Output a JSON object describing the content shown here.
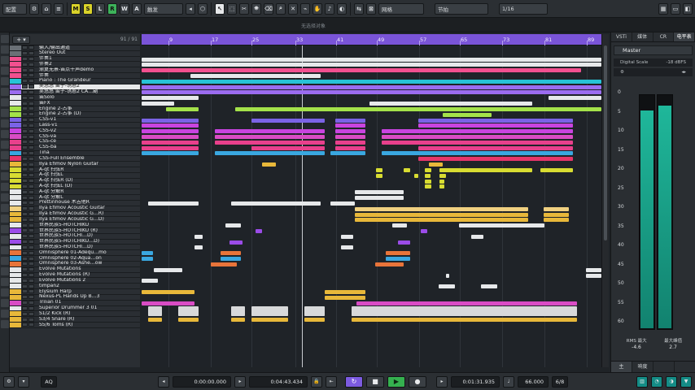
{
  "toolbar": {
    "layout_label": "配置",
    "ab_label": "A B",
    "m_label": "M",
    "s_label": "S",
    "l_label": "L",
    "r_label": "R",
    "w_label": "W",
    "a_label": "A",
    "mode_select": "触发",
    "snap_select": "网格",
    "grid_select": "节拍",
    "quantize_select": "1/16"
  },
  "subbar": {
    "status": "无选择对象"
  },
  "trackheader": {
    "add_label": "+ ▾",
    "count": "91 / 91"
  },
  "tracks": [
    {
      "name": "输入/输出通道",
      "color": "#6a7076"
    },
    {
      "name": "Stereo Out",
      "color": "#6a7076"
    },
    {
      "name": "伴奏1",
      "color": "#f2508f"
    },
    {
      "name": "伴奏2",
      "color": "#f2508f"
    },
    {
      "name": "渐复无景-笛点干声demo",
      "color": "#f2508f"
    },
    {
      "name": "伴奏",
      "color": "#f2508f"
    },
    {
      "name": "Piano : The Grandeur",
      "color": "#27c3d6"
    },
    {
      "name": "吴悠悠 笛子-诱惑2",
      "color": "#9b6cf0"
    },
    {
      "name": "吴悠悠 笛子-诱惑2 CA…副",
      "color": "#9b6cf0"
    },
    {
      "name": "笛Solo",
      "color": "#e6e8ea"
    },
    {
      "name": "笛FX",
      "color": "#e6e8ea"
    },
    {
      "name": "Engine 2-古筝",
      "color": "#a4e24a"
    },
    {
      "name": "Engine 2-古筝 (D)",
      "color": "#a4e24a"
    },
    {
      "name": "CSS-v1",
      "color": "#7b63e6"
    },
    {
      "name": "Lass-v1",
      "color": "#7b63e6"
    },
    {
      "name": "CSS-v2",
      "color": "#c944e0"
    },
    {
      "name": "CSS-va",
      "color": "#d94cc5"
    },
    {
      "name": "CSS-ce",
      "color": "#e8408c"
    },
    {
      "name": "CSS-ba",
      "color": "#e8408c"
    },
    {
      "name": "Tina",
      "color": "#3aa7e0"
    },
    {
      "name": "CSS-Full Ensemble",
      "color": "#e6356a"
    },
    {
      "name": "Ilya Efimov Nylon Guitar",
      "color": "#e8b83a"
    },
    {
      "name": "A-qt 扫弦R",
      "color": "#d8dc32"
    },
    {
      "name": "A-qt 扫弦L",
      "color": "#d8dc32"
    },
    {
      "name": "A-qt 扫弦R (D)",
      "color": "#d8dc32"
    },
    {
      "name": "A-qt 扫弦L (D)",
      "color": "#d8dc32"
    },
    {
      "name": "A-qt 分解R",
      "color": "#e6e8ea"
    },
    {
      "name": "A-qt 分解L",
      "color": "#e6e8ea"
    },
    {
      "name": "Prettinhouse 木吉他R",
      "color": "#e6e8ea"
    },
    {
      "name": "Ilya Efimov Acoustic Guitar",
      "color": "#f0d080"
    },
    {
      "name": "Ilya Efimov Acoustic G…R)",
      "color": "#e8b83a"
    },
    {
      "name": "Ilya Efimov Acoustic G…D)",
      "color": "#e8b83a"
    },
    {
      "name": "世界民族5-HOTCHIKU",
      "color": "#e6e8ea"
    },
    {
      "name": "世界民族5-HOTCHIKU (R)",
      "color": "#9b4ce8"
    },
    {
      "name": "世界民族5-HOTCHI…D)",
      "color": "#e6e8ea"
    },
    {
      "name": "世界民族5-HOTCHIKU…D)",
      "color": "#9b4ce8"
    },
    {
      "name": "世界民族5-HOTCHI…D)",
      "color": "#e6e8ea"
    },
    {
      "name": "Omnisphere 01-Adequ…mo",
      "color": "#e8743a"
    },
    {
      "name": "Omnisphere 02-Aqua…on",
      "color": "#3aa7e0"
    },
    {
      "name": "Omnisphere 03-Ashe…ow",
      "color": "#e8743a"
    },
    {
      "name": "Evolve Mutations",
      "color": "#e6e8ea"
    },
    {
      "name": "Evolve Mutations (R)",
      "color": "#e6e8ea"
    },
    {
      "name": "Evolve Mutations 2",
      "color": "#e6e8ea"
    },
    {
      "name": "timpan2",
      "color": "#e6e8ea"
    },
    {
      "name": "Elysium Harp",
      "color": "#e8b83a"
    },
    {
      "name": "Nexus-PL Hands Up B…3",
      "color": "#e8b83a"
    },
    {
      "name": "Trilian 01",
      "color": "#d94cc5"
    },
    {
      "name": "Superior Drummer 3 01",
      "color": "#e6e8ea"
    },
    {
      "name": "S1/2 Kick (R)",
      "color": "#e8b83a"
    },
    {
      "name": "S3/4 Snare (R)",
      "color": "#e8b83a"
    },
    {
      "name": "S5/6 Toms (R)",
      "color": "#e8b83a"
    }
  ],
  "ruler": {
    "bars": [
      "9",
      "17",
      "25",
      "33",
      "41",
      "49",
      "57",
      "65",
      "73",
      "81",
      "89"
    ]
  },
  "right_panel": {
    "tabs": [
      "VSTi",
      "媒体",
      "CR",
      "电平表"
    ],
    "master_label": "Master",
    "digital_scale_label": "Digital Scale",
    "digital_scale_value": "-18 dBFS",
    "scale": [
      "0",
      "5",
      "10",
      "15",
      "20",
      "25",
      "30",
      "35",
      "40",
      "45",
      "50",
      "55",
      "60"
    ],
    "rms_label": "RMS 最大",
    "rms_value": "-4.6",
    "peak_label": "最大峰值",
    "peak_value": "2.7",
    "meter_left_level": 0.93,
    "meter_right_level": 0.95,
    "bottom_tabs": [
      "主",
      "响度",
      "",
      ""
    ]
  },
  "transport": {
    "position_start": "0:00:00.000",
    "position_end": "0:04:43.434",
    "time_display": "0:01:31.935",
    "tempo": "66.000",
    "signature": "6/8",
    "aq_label": "AQ"
  }
}
